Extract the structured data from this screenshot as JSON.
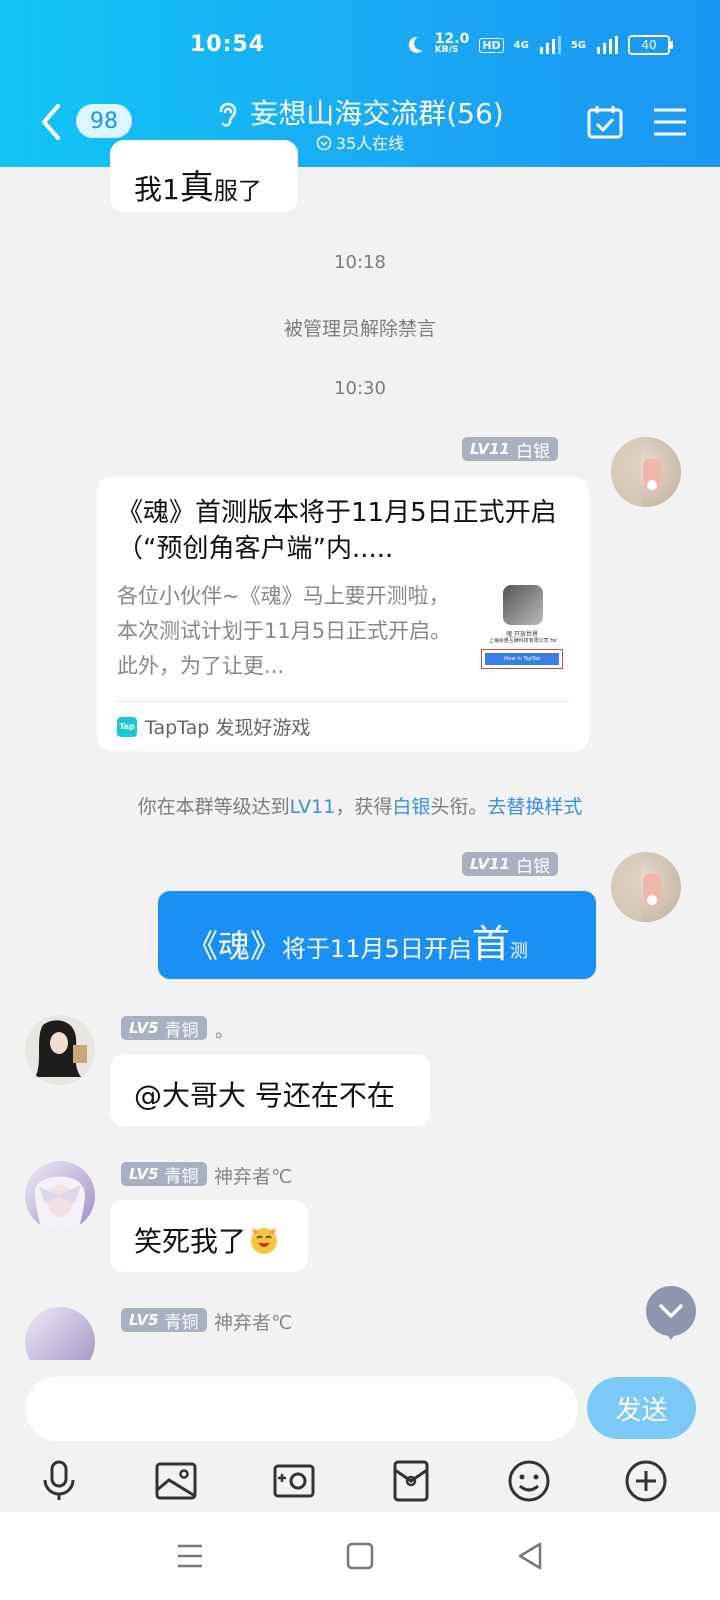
{
  "status": {
    "time": "10:54",
    "speed_value": "12.0",
    "speed_unit": "KB/S",
    "hd": "HD",
    "net4g": "4G",
    "net5g": "5G",
    "battery": "40"
  },
  "header": {
    "unread_count": "98",
    "group_name": "妄想山海交流群(56)",
    "online": "35人在线"
  },
  "messages": {
    "prev_text_a": "我1",
    "prev_text_b": "真",
    "prev_text_c": "服了",
    "time1": "10:18",
    "sys_unmute": "被管理员解除禁言",
    "time2": "10:30",
    "self_level": "LV11",
    "self_title": "白银",
    "card_title": "《魂》首测版本将于11月5日正式开启（“预创角客户端”内.....",
    "card_desc": "各位小伙伴~《魂》马上要开测啦，本次测试计划于11月5日正式开启。此外，为了让更...",
    "card_source": "TapTap 发现好游戏",
    "card_thumb_line1": "魂 开放世界",
    "card_thumb_line2": "上海尚惠互娱科技有限公司 for",
    "card_thumb_btn": "View in TapTap",
    "level_up_a": "你在本群等级达到",
    "level_up_level": "LV11",
    "level_up_b": "，获得",
    "level_up_title": "白银",
    "level_up_c": "头衔。",
    "level_up_link": "去替换样式",
    "blue_a": "《魂》",
    "blue_b": "将于11月5日开启",
    "blue_c": "首",
    "blue_d": "测",
    "user1_level": "LV5",
    "user1_title": "青铜",
    "user1_nick": "。",
    "user1_text": "@大哥大 号还在不在",
    "user2_level": "LV5",
    "user2_title": "青铜",
    "user2_nick": "神弃者℃",
    "user2_text": "笑死我了",
    "user3_level": "LV5",
    "user3_title": "青铜",
    "user3_nick": "神弃者℃"
  },
  "input": {
    "placeholder": "",
    "send_label": "发送"
  },
  "tools": [
    "voice-icon",
    "image-icon",
    "camera-icon",
    "red-packet-icon",
    "emoji-icon",
    "plus-icon"
  ],
  "colors": {
    "header_start": "#12c6f5",
    "header_end": "#1b96f2",
    "bubble_blue": "#1a8ff5",
    "link_blue": "#3a8fe0",
    "badge_gray": "#a9b0c2"
  }
}
